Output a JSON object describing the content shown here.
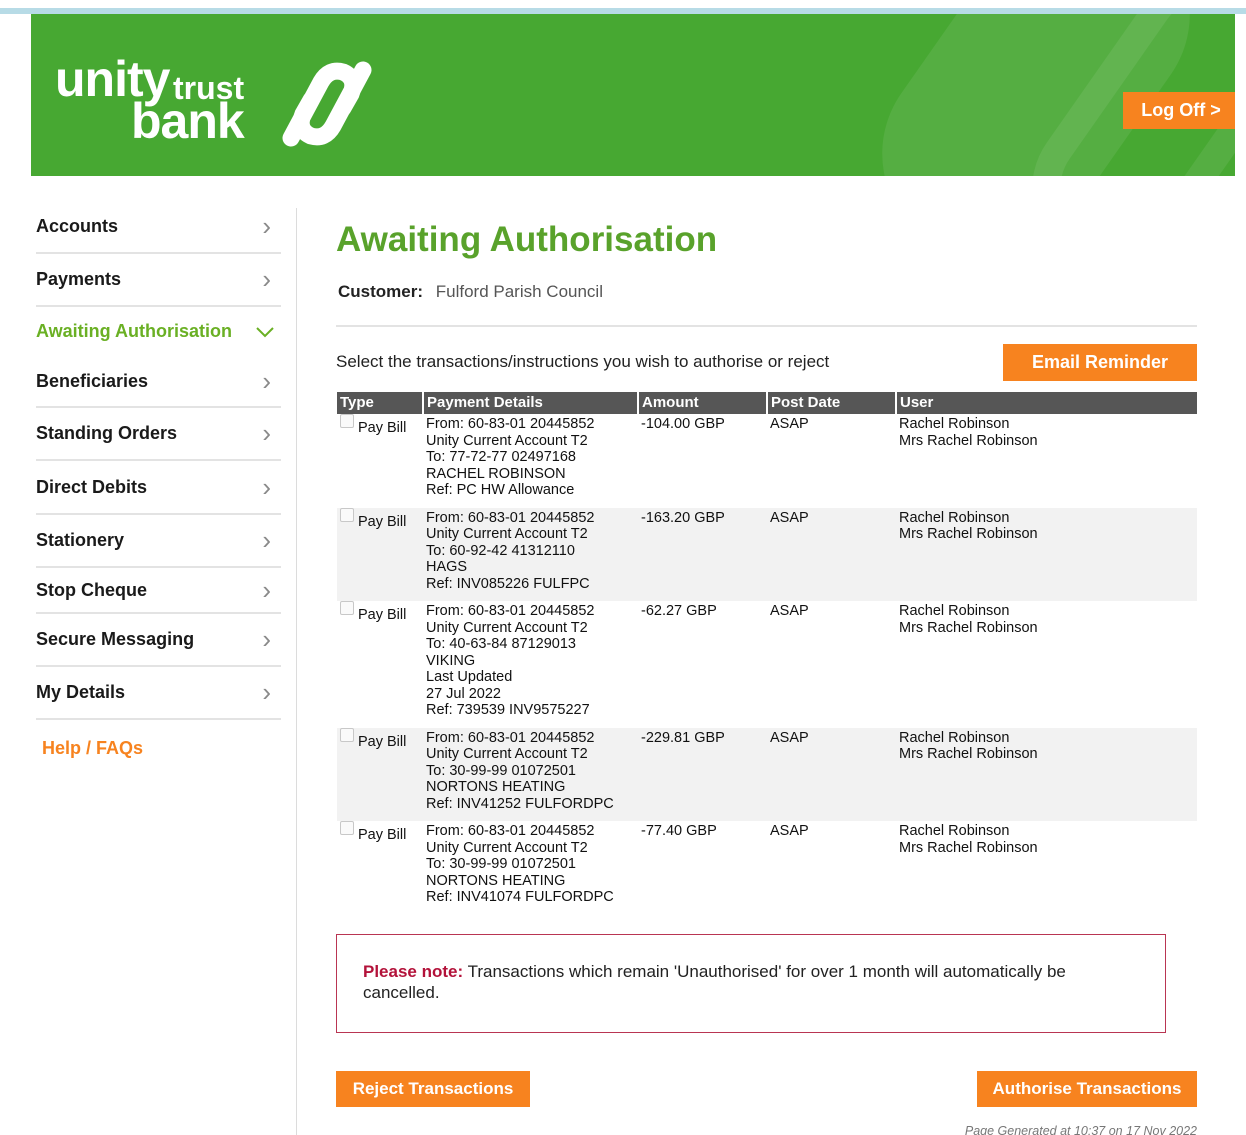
{
  "header": {
    "logo_unity": "unity",
    "logo_trust": "trust",
    "logo_bank": "bank",
    "logoff_label": "Log Off >"
  },
  "colors": {
    "brand_green": "#47a832",
    "accent_orange": "#f7831f",
    "title_green": "#59a22b",
    "note_red": "#b3123a"
  },
  "sidebar": {
    "items": [
      {
        "label": "Accounts",
        "icon": "chevron-right-icon"
      },
      {
        "label": "Payments",
        "icon": "chevron-right-icon"
      },
      {
        "label": "Awaiting Authorisation",
        "icon": "chevron-down-icon",
        "active": true
      },
      {
        "label": "Beneficiaries",
        "icon": "chevron-right-icon"
      },
      {
        "label": "Standing Orders",
        "icon": "chevron-right-icon"
      },
      {
        "label": "Direct Debits",
        "icon": "chevron-right-icon"
      },
      {
        "label": "Stationery",
        "icon": "chevron-right-icon"
      },
      {
        "label": "Stop Cheque",
        "icon": "chevron-right-icon"
      },
      {
        "label": "Secure Messaging",
        "icon": "chevron-right-icon"
      },
      {
        "label": "My Details",
        "icon": "chevron-right-icon"
      }
    ],
    "help": "Help / FAQs"
  },
  "main": {
    "title": "Awaiting Authorisation",
    "customer_label": "Customer:",
    "customer_value": "Fulford Parish Council",
    "instruction": "Select the transactions/instructions you wish to authorise or reject",
    "email_reminder": "Email Reminder",
    "table": {
      "headers": [
        "Type",
        "Payment Details",
        "Amount",
        "Post Date",
        "User"
      ],
      "rows": [
        {
          "type": "Pay Bill",
          "details": [
            "From: 60-83-01 20445852",
            "Unity Current Account T2",
            "To: 77-72-77 02497168",
            "RACHEL ROBINSON",
            "Ref: PC HW Allowance"
          ],
          "amount": "-104.00 GBP",
          "post_date": "ASAP",
          "user": [
            "Rachel Robinson",
            "Mrs Rachel Robinson"
          ]
        },
        {
          "type": "Pay Bill",
          "details": [
            "From: 60-83-01 20445852",
            "Unity Current Account T2",
            "To: 60-92-42 41312110",
            "HAGS",
            "Ref: INV085226 FULFPC"
          ],
          "amount": "-163.20 GBP",
          "post_date": "ASAP",
          "user": [
            "Rachel Robinson",
            "Mrs Rachel Robinson"
          ]
        },
        {
          "type": "Pay Bill",
          "details": [
            "From: 60-83-01 20445852",
            "Unity Current Account T2",
            "To: 40-63-84 87129013",
            "VIKING",
            "Last Updated",
            "27 Jul 2022",
            "Ref: 739539 INV9575227"
          ],
          "amount": "-62.27 GBP",
          "post_date": "ASAP",
          "user": [
            "Rachel Robinson",
            "Mrs Rachel Robinson"
          ]
        },
        {
          "type": "Pay Bill",
          "details": [
            "From: 60-83-01 20445852",
            "Unity Current Account T2",
            "To: 30-99-99 01072501",
            "NORTONS HEATING",
            "Ref: INV41252 FULFORDPC"
          ],
          "amount": "-229.81 GBP",
          "post_date": "ASAP",
          "user": [
            "Rachel Robinson",
            "Mrs Rachel Robinson"
          ]
        },
        {
          "type": "Pay Bill",
          "details": [
            "From: 60-83-01 20445852",
            "Unity Current Account T2",
            "To: 30-99-99 01072501",
            "NORTONS HEATING",
            "Ref: INV41074 FULFORDPC"
          ],
          "amount": "-77.40 GBP",
          "post_date": "ASAP",
          "user": [
            "Rachel Robinson",
            "Mrs Rachel Robinson"
          ]
        }
      ]
    },
    "note_emphasis": "Please note:",
    "note_text": " Transactions which remain 'Unauthorised' for over 1 month will automatically be cancelled.",
    "reject_label": "Reject Transactions",
    "authorise_label": "Authorise Transactions",
    "generated": "Page Generated at 10:37 on 17 Nov 2022"
  }
}
